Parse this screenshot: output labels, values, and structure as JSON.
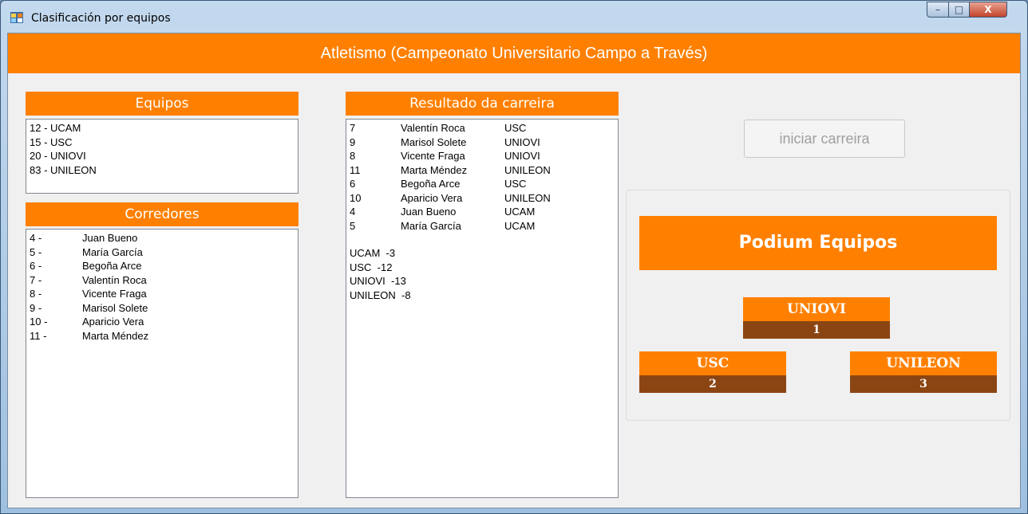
{
  "window": {
    "title": "Clasificación por equipos",
    "minimize_glyph": "–",
    "maximize_glyph": "□",
    "close_glyph": "X"
  },
  "header": {
    "title": "Atletismo (Campeonato Universitario Campo a Través)"
  },
  "equipos": {
    "heading": "Equipos",
    "items": [
      "12 - UCAM",
      "15 - USC",
      "20 - UNIOVI",
      "83 - UNILEON"
    ]
  },
  "corredores": {
    "heading": "Corredores",
    "items": [
      {
        "num": "4 -",
        "name": "Juan Bueno"
      },
      {
        "num": "5 -",
        "name": "María García"
      },
      {
        "num": "6 -",
        "name": "Begoña Arce"
      },
      {
        "num": "7 -",
        "name": "Valentín Roca"
      },
      {
        "num": "8 -",
        "name": "Vicente Fraga"
      },
      {
        "num": "9 -",
        "name": "Marisol Solete"
      },
      {
        "num": "10 -",
        "name": "Aparicio Vera"
      },
      {
        "num": "11 -",
        "name": "Marta Méndez"
      }
    ]
  },
  "resultado": {
    "heading": "Resultado da carreira",
    "rows": [
      {
        "num": "7",
        "name": "Valentín Roca",
        "team": "USC"
      },
      {
        "num": "9",
        "name": "Marisol Solete",
        "team": "UNIOVI"
      },
      {
        "num": "8",
        "name": "Vicente Fraga",
        "team": "UNIOVI"
      },
      {
        "num": "11",
        "name": "Marta Méndez",
        "team": "UNILEON"
      },
      {
        "num": "6",
        "name": "Begoña Arce",
        "team": "USC"
      },
      {
        "num": "10",
        "name": "Aparicio Vera",
        "team": "UNILEON"
      },
      {
        "num": "4",
        "name": "Juan Bueno",
        "team": "UCAM"
      },
      {
        "num": "5",
        "name": "María García",
        "team": "UCAM"
      }
    ],
    "scores": [
      "UCAM  -3",
      "USC  -12",
      "UNIOVI  -13",
      "UNILEON  -8"
    ]
  },
  "start_button": {
    "label": "iniciar carreira"
  },
  "podium": {
    "title": "Podium Equipos",
    "first": {
      "team": "UNIOVI",
      "rank": "1"
    },
    "second": {
      "team": "USC",
      "rank": "2"
    },
    "third": {
      "team": "UNILEON",
      "rank": "3"
    }
  },
  "colors": {
    "accent": "#ff8000",
    "rank_bar": "#8b4513"
  }
}
